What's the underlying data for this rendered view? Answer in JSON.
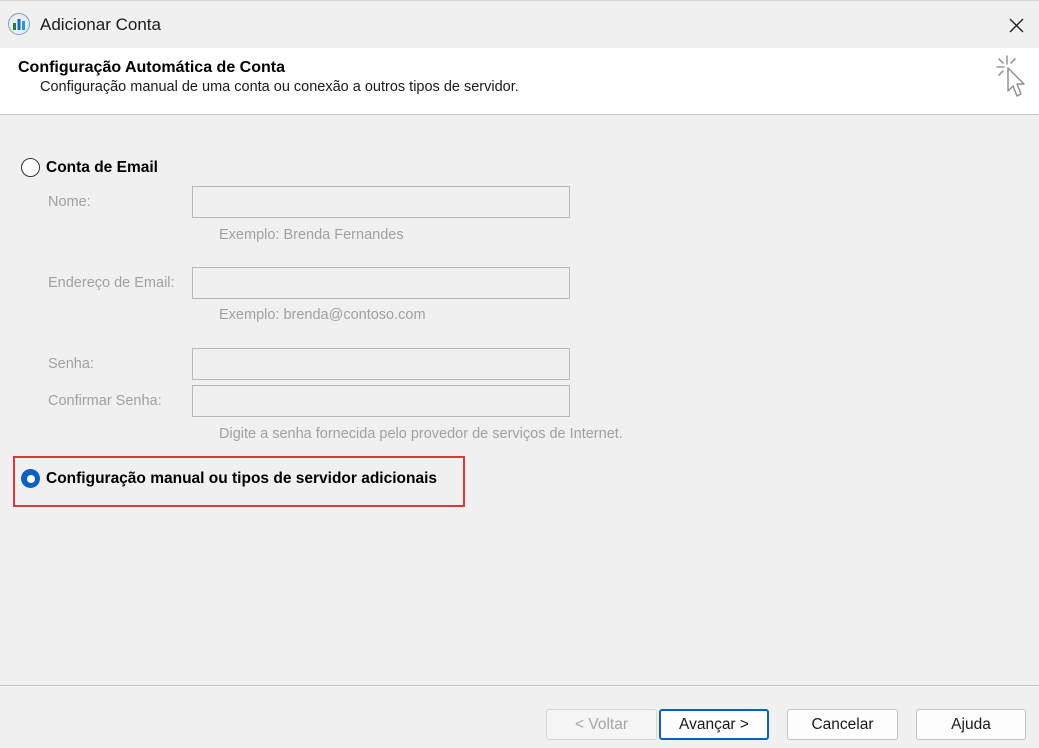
{
  "window": {
    "title": "Adicionar Conta",
    "app_icon": "outlook-account-icon",
    "close_icon": "close-icon"
  },
  "header": {
    "title": "Configuração Automática de Conta",
    "subtitle": "Configuração manual de uma conta ou conexão a outros tipos de servidor.",
    "icon": "wizard-cursor-sparkle-icon"
  },
  "options": {
    "email_account": {
      "label": "Conta de Email",
      "selected": false
    },
    "manual_setup": {
      "label": "Configuração manual ou tipos de servidor adicionais",
      "selected": true
    }
  },
  "form": {
    "name": {
      "label": "Nome:",
      "value": "",
      "hint": "Exemplo: Brenda Fernandes"
    },
    "email": {
      "label": "Endereço de Email:",
      "value": "",
      "hint": "Exemplo: brenda@contoso.com"
    },
    "password": {
      "label": "Senha:",
      "value": ""
    },
    "confirm_password": {
      "label": "Confirmar Senha:",
      "value": "",
      "hint": "Digite a senha fornecida pelo provedor de serviços de Internet."
    }
  },
  "buttons": {
    "back": "< Voltar",
    "next": "Avançar >",
    "cancel": "Cancelar",
    "help": "Ajuda"
  },
  "colors": {
    "accent": "#0a5fc2",
    "highlight": "#d9393a",
    "disabled_text": "#a0a0a0"
  }
}
